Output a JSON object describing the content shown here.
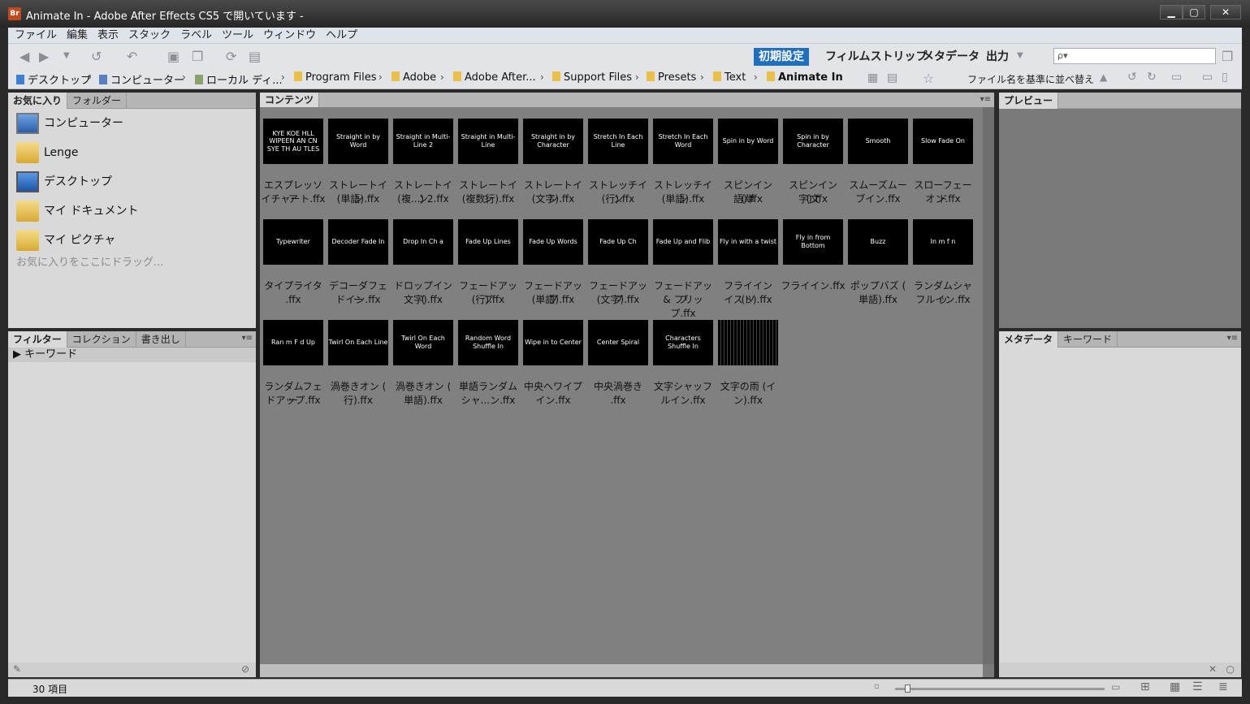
{
  "window": {
    "app_icon": "Br",
    "title": "Animate In - Adobe After Effects CS5 で開いています -",
    "controls": [
      "minimize-icon",
      "maximize-icon",
      "close-icon"
    ]
  },
  "menu": [
    "ファイル",
    "編集",
    "表示",
    "スタック",
    "ラベル",
    "ツール",
    "ウィンドウ",
    "ヘルプ"
  ],
  "workspaces": [
    {
      "label": "初期設定",
      "active": true
    },
    {
      "label": "フィルムストリップ",
      "active": false
    },
    {
      "label": "メタデータ",
      "active": false
    },
    {
      "label": "出力",
      "active": false
    }
  ],
  "search": {
    "placeholder": "ρ▾"
  },
  "breadcrumb": [
    "デスクトップ",
    "コンピューター",
    "ローカル ディ...",
    "Program Files",
    "Adobe",
    "Adobe After...",
    "Support Files",
    "Presets",
    "Text",
    "Animate In"
  ],
  "sort_label": "ファイル名を基準に並べ替え",
  "left_top_panel": {
    "tabs": [
      "お気に入り",
      "フォルダー"
    ],
    "favorites": [
      "コンピューター",
      "Lenge",
      "デスクトップ",
      "マイ ドキュメント",
      "マイ ピクチャ"
    ],
    "hint": "お気に入りをここにドラッグ..."
  },
  "left_bottom_panel": {
    "tabs": [
      "フィルター",
      "コレクション",
      "書き出し"
    ],
    "keyword_row": "キーワード"
  },
  "content_panel": {
    "tab": "コンテンツ"
  },
  "right_top_panel": {
    "tab": "プレビュー"
  },
  "right_bottom_panel": {
    "tabs": [
      "メタデータ",
      "キーワード"
    ]
  },
  "items": [
    {
      "thumb": "KYE KOE HLL WIPEEN AN CN SYE TH AU TLES",
      "l1": "エスプレッソア",
      "l2": "イチャート.ffx"
    },
    {
      "thumb": "Straight in by Word",
      "l1": "ストレートイン",
      "l2": "(単語).ffx"
    },
    {
      "thumb": "Straight in Multi-Line 2",
      "l1": "ストレートイン",
      "l2": "(複...) 2.ffx"
    },
    {
      "thumb": "Straight in Multi-Line",
      "l1": "ストレートイン",
      "l2": "(複数行).ffx"
    },
    {
      "thumb": "Straight in by Character",
      "l1": "ストレートイン",
      "l2": "(文字).ffx"
    },
    {
      "thumb": "Stretch In Each Line",
      "l1": "ストレッチイン",
      "l2": "(行).ffx"
    },
    {
      "thumb": "Stretch In Each Word",
      "l1": "ストレッチイン",
      "l2": "(単語).ffx"
    },
    {
      "thumb": "Spin in by Word",
      "l1": "スピンイン (単",
      "l2": "語).ffx"
    },
    {
      "thumb": "Spin in by Character",
      "l1": "スピンイン (文",
      "l2": "字).ffx"
    },
    {
      "thumb": "Smooth",
      "l1": "スムーズムー",
      "l2": "ブイン.ffx"
    },
    {
      "thumb": "Slow Fade On",
      "l1": "スローフェード",
      "l2": "オン.ffx"
    },
    {
      "thumb": "Typewriter",
      "l1": "タイプライタ",
      "l2": ".ffx"
    },
    {
      "thumb": "Decoder Fade In",
      "l1": "デコーダフェー",
      "l2": "ドイン.ffx"
    },
    {
      "thumb": "Drop In Ch a",
      "l1": "ドロップイン (",
      "l2": "文字).ffx"
    },
    {
      "thumb": "Fade Up Lines",
      "l1": "フェードアップ",
      "l2": "(行).ffx"
    },
    {
      "thumb": "Fade Up Words",
      "l1": "フェードアップ",
      "l2": "(単語).ffx"
    },
    {
      "thumb": "Fade Up Ch",
      "l1": "フェードアップ",
      "l2": "(文字).ffx"
    },
    {
      "thumb": "Fade Up and Flib",
      "l1": "フェードアップ",
      "l2": "& フリップ.ffx"
    },
    {
      "thumb": "Fly in with a twist",
      "l1": "フライイン (ツ",
      "l2": "イスト).ffx"
    },
    {
      "thumb": "Fly in from Bottom",
      "l1": "フライイン.ffx",
      "l2": ""
    },
    {
      "thumb": "Buzz",
      "l1": "ポップバズ (",
      "l2": "単語).ffx"
    },
    {
      "thumb": "In m  f  n",
      "l1": "ランダムシャッ",
      "l2": "フルイン.ffx"
    },
    {
      "thumb": "Ran m F d Up",
      "l1": "ランダムフェー",
      "l2": "ドアップ.ffx"
    },
    {
      "thumb": "Twirl On Each Line",
      "l1": "渦巻きオン (",
      "l2": "行).ffx"
    },
    {
      "thumb": "Twirl On Each Word",
      "l1": "渦巻きオン (",
      "l2": "単語).ffx"
    },
    {
      "thumb": "Random Word Shuffle In",
      "l1": "単語ランダム",
      "l2": "シャ...ン.ffx"
    },
    {
      "thumb": "Wipe in to Center",
      "l1": "中央へワイプ",
      "l2": "イン.ffx"
    },
    {
      "thumb": "Center Spiral",
      "l1": "中央渦巻き",
      "l2": ".ffx"
    },
    {
      "thumb": "Characters Shuffle In",
      "l1": "文字シャッフ",
      "l2": "ルイン.ffx"
    },
    {
      "thumb": "",
      "l1": "文字の雨 (イ",
      "l2": "ン).ffx"
    }
  ],
  "status": {
    "count": "30 項目"
  },
  "colors": {
    "workspace_active": "#1f6fbf",
    "content_bg": "#808080",
    "thumb_bg": "#000000"
  }
}
